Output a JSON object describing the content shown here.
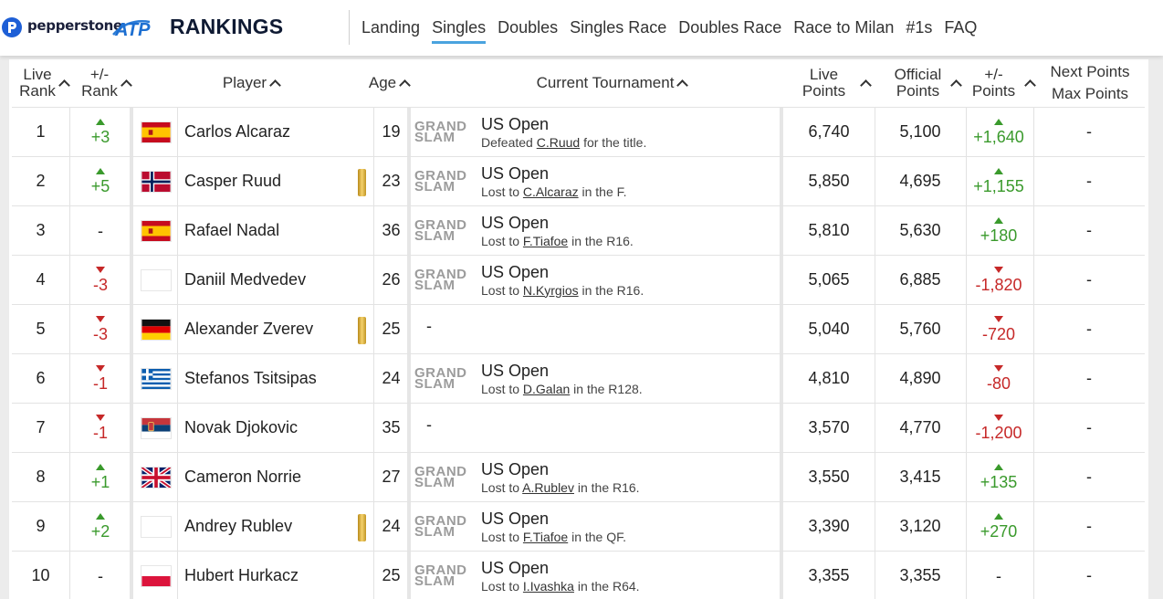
{
  "header": {
    "pepperstone_label": "pepperstone",
    "atp_label": "ATP",
    "rankings_label": "RANKINGS",
    "nav": [
      {
        "label": "Landing",
        "active": false
      },
      {
        "label": "Singles",
        "active": true
      },
      {
        "label": "Doubles",
        "active": false
      },
      {
        "label": "Singles Race",
        "active": false
      },
      {
        "label": "Doubles Race",
        "active": false
      },
      {
        "label": "Race to Milan",
        "active": false
      },
      {
        "label": "#1s",
        "active": false
      },
      {
        "label": "FAQ",
        "active": false
      }
    ]
  },
  "columns": {
    "live_rank": [
      "Live",
      "Rank"
    ],
    "rank_change": [
      "+/-",
      "Rank"
    ],
    "player": "Player",
    "age": "Age",
    "tournament": "Current Tournament",
    "live_points": [
      "Live",
      "Points"
    ],
    "official_points": [
      "Official",
      "Points"
    ],
    "points_change": [
      "+/-",
      "Points"
    ],
    "next_max": [
      "Next Points",
      "Max Points"
    ]
  },
  "grand_slam_label": [
    "GRAND",
    "SLAM"
  ],
  "colors": {
    "up": "#3a9a2c",
    "down": "#c62828",
    "accent": "#4aa3df"
  },
  "rows": [
    {
      "rank": "1",
      "change": "+3",
      "dir": "up",
      "flag": "spain",
      "name": "Carlos Alcaraz",
      "gold": false,
      "age": "19",
      "grand_slam": true,
      "tournament": "US Open",
      "detail_pre": "Defeated ",
      "opponent": "C.Ruud",
      "detail_post": " for the title.",
      "live_points": "6,740",
      "official_points": "5,100",
      "points_change": "+1,640",
      "pdir": "up",
      "next": "-"
    },
    {
      "rank": "2",
      "change": "+5",
      "dir": "up",
      "flag": "norway",
      "name": "Casper Ruud",
      "gold": true,
      "age": "23",
      "grand_slam": true,
      "tournament": "US Open",
      "detail_pre": "Lost to ",
      "opponent": "C.Alcaraz",
      "detail_post": " in the F.",
      "live_points": "5,850",
      "official_points": "4,695",
      "points_change": "+1,155",
      "pdir": "up",
      "next": "-"
    },
    {
      "rank": "3",
      "change": "-",
      "dir": "none",
      "flag": "spain",
      "name": "Rafael Nadal",
      "gold": false,
      "age": "36",
      "grand_slam": true,
      "tournament": "US Open",
      "detail_pre": "Lost to ",
      "opponent": "F.Tiafoe",
      "detail_post": " in the R16.",
      "live_points": "5,810",
      "official_points": "5,630",
      "points_change": "+180",
      "pdir": "up",
      "next": "-"
    },
    {
      "rank": "4",
      "change": "-3",
      "dir": "down",
      "flag": "blank",
      "name": "Daniil Medvedev",
      "gold": false,
      "age": "26",
      "grand_slam": true,
      "tournament": "US Open",
      "detail_pre": "Lost to ",
      "opponent": "N.Kyrgios",
      "detail_post": " in the R16.",
      "live_points": "5,065",
      "official_points": "6,885",
      "points_change": "-1,820",
      "pdir": "down",
      "next": "-"
    },
    {
      "rank": "5",
      "change": "-3",
      "dir": "down",
      "flag": "germany",
      "name": "Alexander Zverev",
      "gold": true,
      "age": "25",
      "grand_slam": false,
      "tournament": "-",
      "detail_pre": "",
      "opponent": "",
      "detail_post": "",
      "live_points": "5,040",
      "official_points": "5,760",
      "points_change": "-720",
      "pdir": "down",
      "next": "-"
    },
    {
      "rank": "6",
      "change": "-1",
      "dir": "down",
      "flag": "greece",
      "name": "Stefanos Tsitsipas",
      "gold": false,
      "age": "24",
      "grand_slam": true,
      "tournament": "US Open",
      "detail_pre": "Lost to ",
      "opponent": "D.Galan",
      "detail_post": " in the R128.",
      "live_points": "4,810",
      "official_points": "4,890",
      "points_change": "-80",
      "pdir": "down",
      "next": "-"
    },
    {
      "rank": "7",
      "change": "-1",
      "dir": "down",
      "flag": "serbia",
      "name": "Novak Djokovic",
      "gold": false,
      "age": "35",
      "grand_slam": false,
      "tournament": "-",
      "detail_pre": "",
      "opponent": "",
      "detail_post": "",
      "live_points": "3,570",
      "official_points": "4,770",
      "points_change": "-1,200",
      "pdir": "down",
      "next": "-"
    },
    {
      "rank": "8",
      "change": "+1",
      "dir": "up",
      "flag": "uk",
      "name": "Cameron Norrie",
      "gold": false,
      "age": "27",
      "grand_slam": true,
      "tournament": "US Open",
      "detail_pre": "Lost to ",
      "opponent": "A.Rublev",
      "detail_post": " in the R16.",
      "live_points": "3,550",
      "official_points": "3,415",
      "points_change": "+135",
      "pdir": "up",
      "next": "-"
    },
    {
      "rank": "9",
      "change": "+2",
      "dir": "up",
      "flag": "blank",
      "name": "Andrey Rublev",
      "gold": true,
      "age": "24",
      "grand_slam": true,
      "tournament": "US Open",
      "detail_pre": "Lost to ",
      "opponent": "F.Tiafoe",
      "detail_post": " in the QF.",
      "live_points": "3,390",
      "official_points": "3,120",
      "points_change": "+270",
      "pdir": "up",
      "next": "-"
    },
    {
      "rank": "10",
      "change": "-",
      "dir": "none",
      "flag": "poland",
      "name": "Hubert Hurkacz",
      "gold": false,
      "age": "25",
      "grand_slam": true,
      "tournament": "US Open",
      "detail_pre": "Lost to ",
      "opponent": "I.Ivashka",
      "detail_post": " in the R64.",
      "live_points": "3,355",
      "official_points": "3,355",
      "points_change": "-",
      "pdir": "none",
      "next": "-"
    }
  ]
}
